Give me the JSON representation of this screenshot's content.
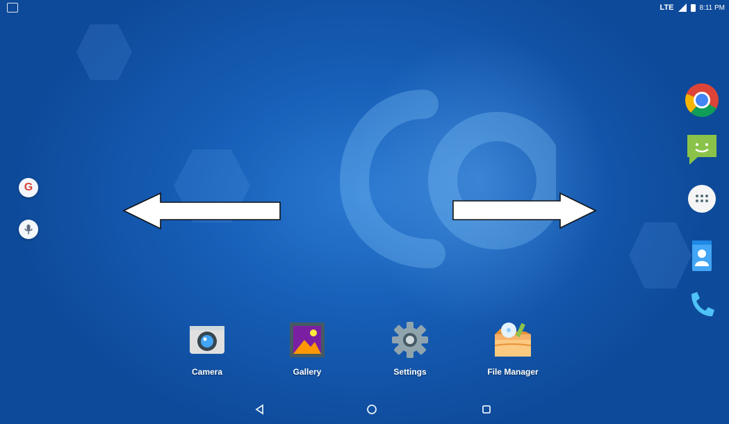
{
  "status_bar": {
    "network": "LTE",
    "time": "8:11 PM"
  },
  "home": {
    "left_shortcuts": [
      {
        "name": "Google",
        "glyph": "G"
      },
      {
        "name": "Voice Search",
        "glyph": "mic"
      }
    ],
    "right_dock": [
      {
        "label": "Chrome",
        "icon": "chrome-icon"
      },
      {
        "label": "Messaging",
        "icon": "message-icon"
      },
      {
        "label": "Apps",
        "icon": "apps-grid-icon"
      },
      {
        "label": "Contacts",
        "icon": "contacts-icon"
      },
      {
        "label": "Phone",
        "icon": "phone-icon"
      }
    ],
    "bottom_apps": [
      {
        "label": "Camera",
        "icon": "camera-icon"
      },
      {
        "label": "Gallery",
        "icon": "gallery-icon"
      },
      {
        "label": "Settings",
        "icon": "settings-icon"
      },
      {
        "label": "File Manager",
        "icon": "file-manager-icon"
      }
    ],
    "annotations": [
      {
        "direction": "left"
      },
      {
        "direction": "right"
      }
    ]
  },
  "colors": {
    "wallpaper": "#175fb8",
    "arrow_fill": "#ffffff",
    "arrow_stroke": "#111111"
  }
}
